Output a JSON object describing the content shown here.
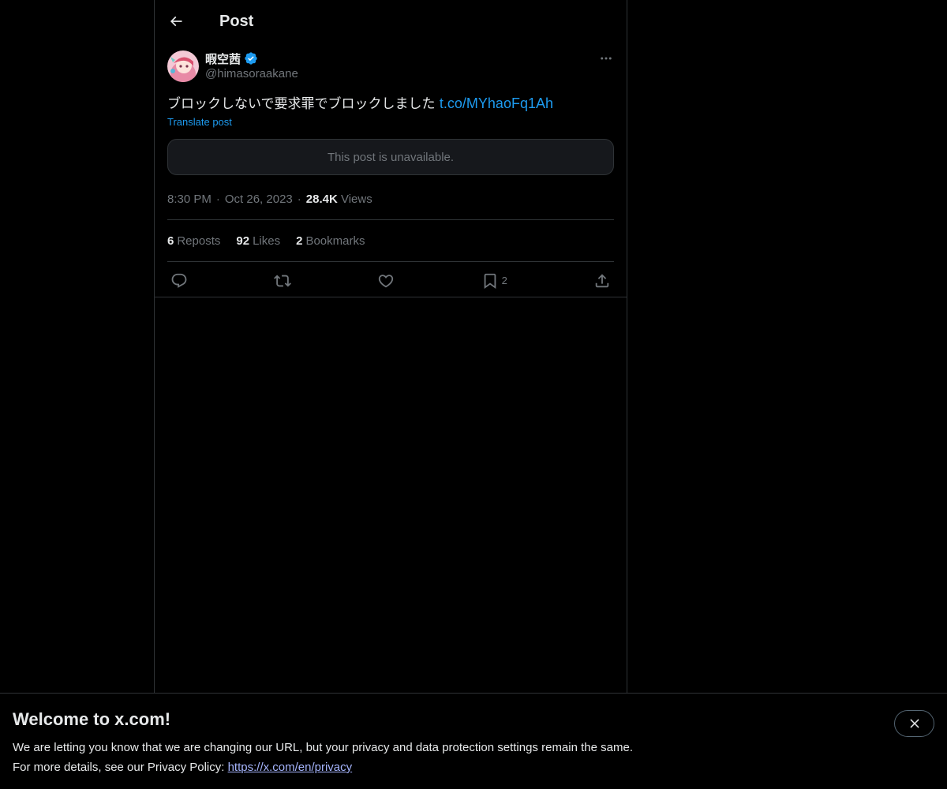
{
  "header": {
    "title": "Post"
  },
  "post": {
    "author": {
      "display_name": "暇空茜",
      "handle": "@himasoraakane",
      "verified": true
    },
    "text": "ブロックしないで要求罪でブロックしました ",
    "link_text": "t.co/MYhaoFq1Ah",
    "translate_label": "Translate post",
    "quoted_unavailable": "This post is unavailable.",
    "time": "8:30 PM",
    "date": "Oct 26, 2023",
    "separator": "·",
    "views_count": "28.4K",
    "views_label": "Views",
    "stats": {
      "reposts_count": "6",
      "reposts_label": "Reposts",
      "likes_count": "92",
      "likes_label": "Likes",
      "bookmarks_count": "2",
      "bookmarks_label": "Bookmarks"
    },
    "actions": {
      "bookmark_count": "2"
    }
  },
  "banner": {
    "title": "Welcome to x.com!",
    "line1": "We are letting you know that we are changing our URL, but your privacy and data protection settings remain the same.",
    "line2_prefix": "For more details, see our Privacy Policy: ",
    "link": "https://x.com/en/privacy"
  },
  "colors": {
    "background": "#000000",
    "text": "#e7e9ea",
    "secondary": "#71767b",
    "accent": "#1d9bf0",
    "border": "#2f3336",
    "verified": "#1d9bf0"
  },
  "icons": {
    "back": "arrow-left-icon",
    "more": "more-dots-icon",
    "verified": "verified-badge-icon",
    "reply": "reply-icon",
    "repost": "repost-icon",
    "like": "heart-icon",
    "bookmark": "bookmark-icon",
    "share": "share-icon",
    "close": "close-icon"
  }
}
